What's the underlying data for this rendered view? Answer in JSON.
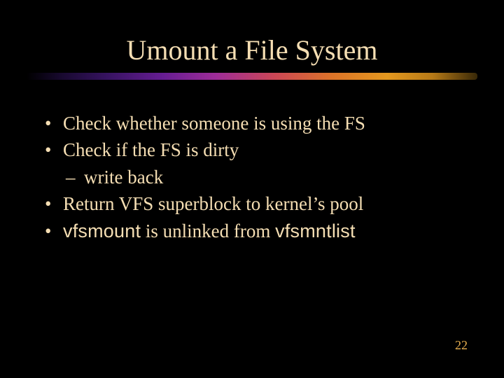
{
  "slide": {
    "title": "Umount a File System",
    "bullets": [
      {
        "text": "Check whether someone is using the FS"
      },
      {
        "text": "Check if the FS is dirty"
      },
      {
        "sub": "write back"
      },
      {
        "text": "Return VFS superblock to kernel’s pool"
      },
      {
        "prefix": "vfsmount",
        "mid": " is unlinked from ",
        "suffix": "vfsmntlist"
      }
    ],
    "page_number": "22"
  }
}
